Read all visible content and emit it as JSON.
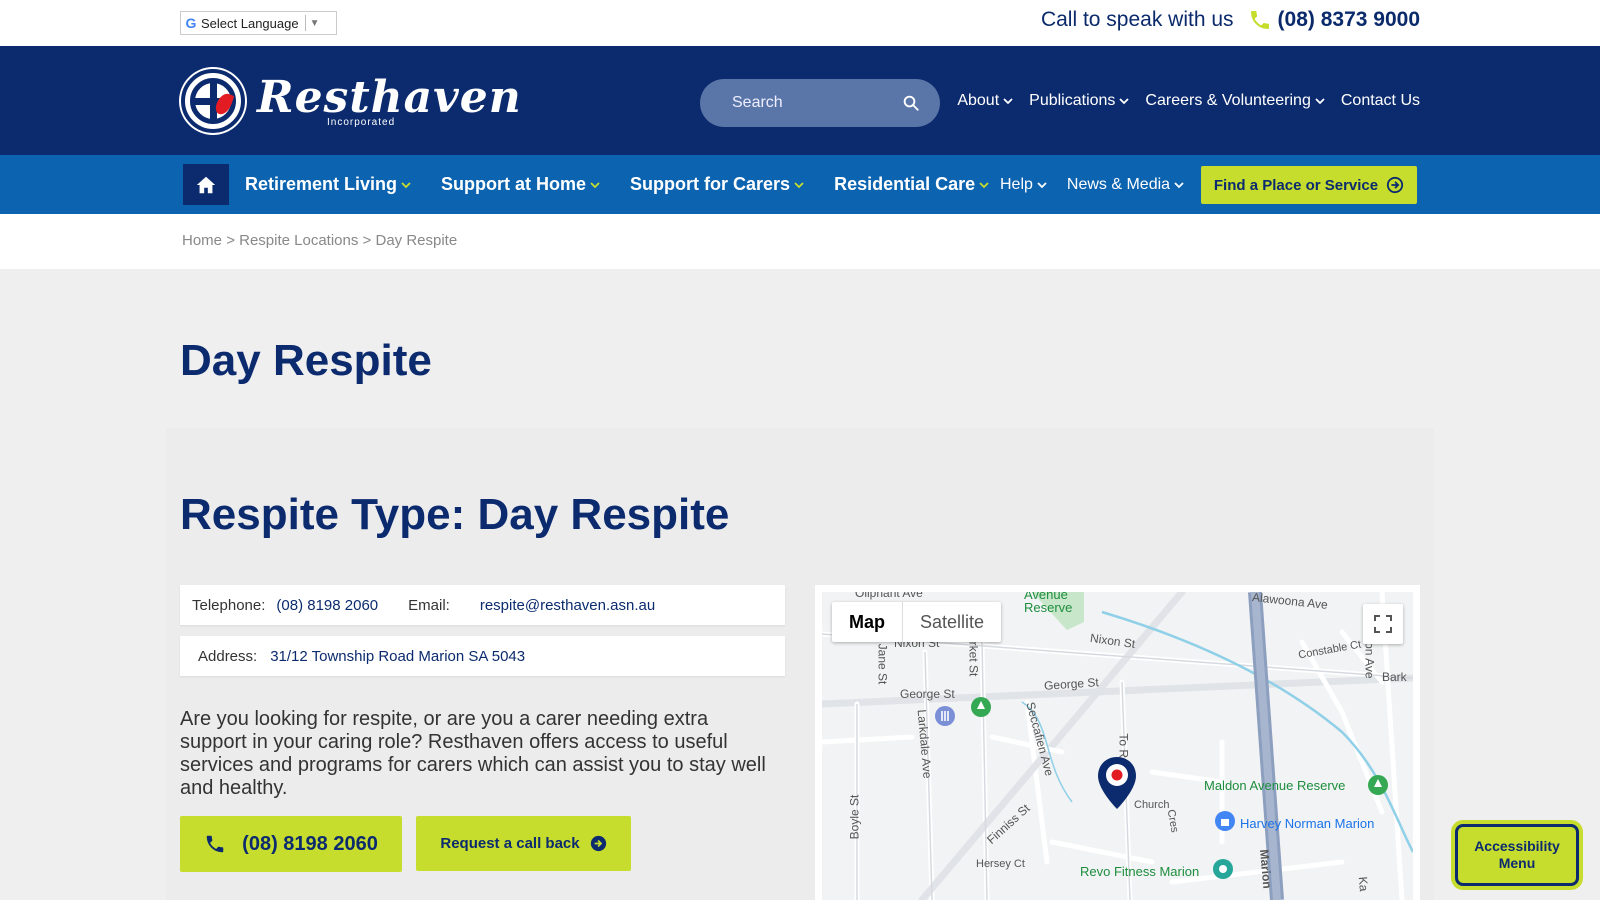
{
  "topbar": {
    "language_label": "Select Language",
    "call_text": "Call to speak with us",
    "phone": "(08) 8373 9000"
  },
  "header": {
    "logo_name": "Resthaven",
    "logo_sub": "Incorporated",
    "search_placeholder": "Search",
    "top_nav": [
      "About",
      "Publications",
      "Careers & Volunteering",
      "Contact Us"
    ]
  },
  "main_nav": {
    "items": [
      "Retirement Living",
      "Support at Home",
      "Support for Carers",
      "Residential Care"
    ],
    "secondary": [
      "Help",
      "News & Media"
    ],
    "cta": "Find a Place or Service"
  },
  "breadcrumb": {
    "home": "Home",
    "sep": ">",
    "middle": "Respite Locations",
    "current": "Day Respite"
  },
  "page": {
    "title": "Day Respite",
    "panel_title": "Respite Type: Day Respite",
    "telephone_label": "Telephone:",
    "telephone": "(08) 8198 2060",
    "email_label": "Email:",
    "email": "respite@resthaven.asn.au",
    "address_label": "Address:",
    "address": "31/12 Township Road Marion SA 5043",
    "intro": "Are you looking for respite, or are you a carer needing extra support in your caring role? Resthaven offers access to useful services and programs for carers which can assist you to stay well and healthy.",
    "phone_button": "(08) 8198 2060",
    "callback_button": "Request a call back"
  },
  "map": {
    "toggle_map": "Map",
    "toggle_satellite": "Satellite",
    "labels": {
      "oliphant": "Oliphant Ave",
      "avenue_reserve": "Avenue\nReserve",
      "alawoona": "Alawoona Ave",
      "nixon1": "Nixon St",
      "nixon2": "Nixon St",
      "constable": "Constable Ct",
      "bark": "Bark",
      "don_ave": "don Ave",
      "george1": "George St",
      "george2": "George St",
      "jane": "Jane St",
      "market": "rket St",
      "larkdale": "Larkdale Ave",
      "seccafien": "Seccafien Ave",
      "township": "To    Rd",
      "finniss": "Finniss St",
      "boyle": "Boyle St",
      "church": "Church",
      "cres": "Cres",
      "hersey": "Hersey Ct",
      "maldon": "Maldon Avenue Reserve",
      "harvey": "Harvey Norman Marion",
      "revo": "Revo Fitness Marion",
      "marion": "Marion",
      "ka": "Ka"
    }
  },
  "accessibility": {
    "line1": "Accessibility",
    "line2": "Menu"
  },
  "colors": {
    "navy": "#0c2b6e",
    "blue": "#0c64b0",
    "lime": "#c6dd2d"
  }
}
